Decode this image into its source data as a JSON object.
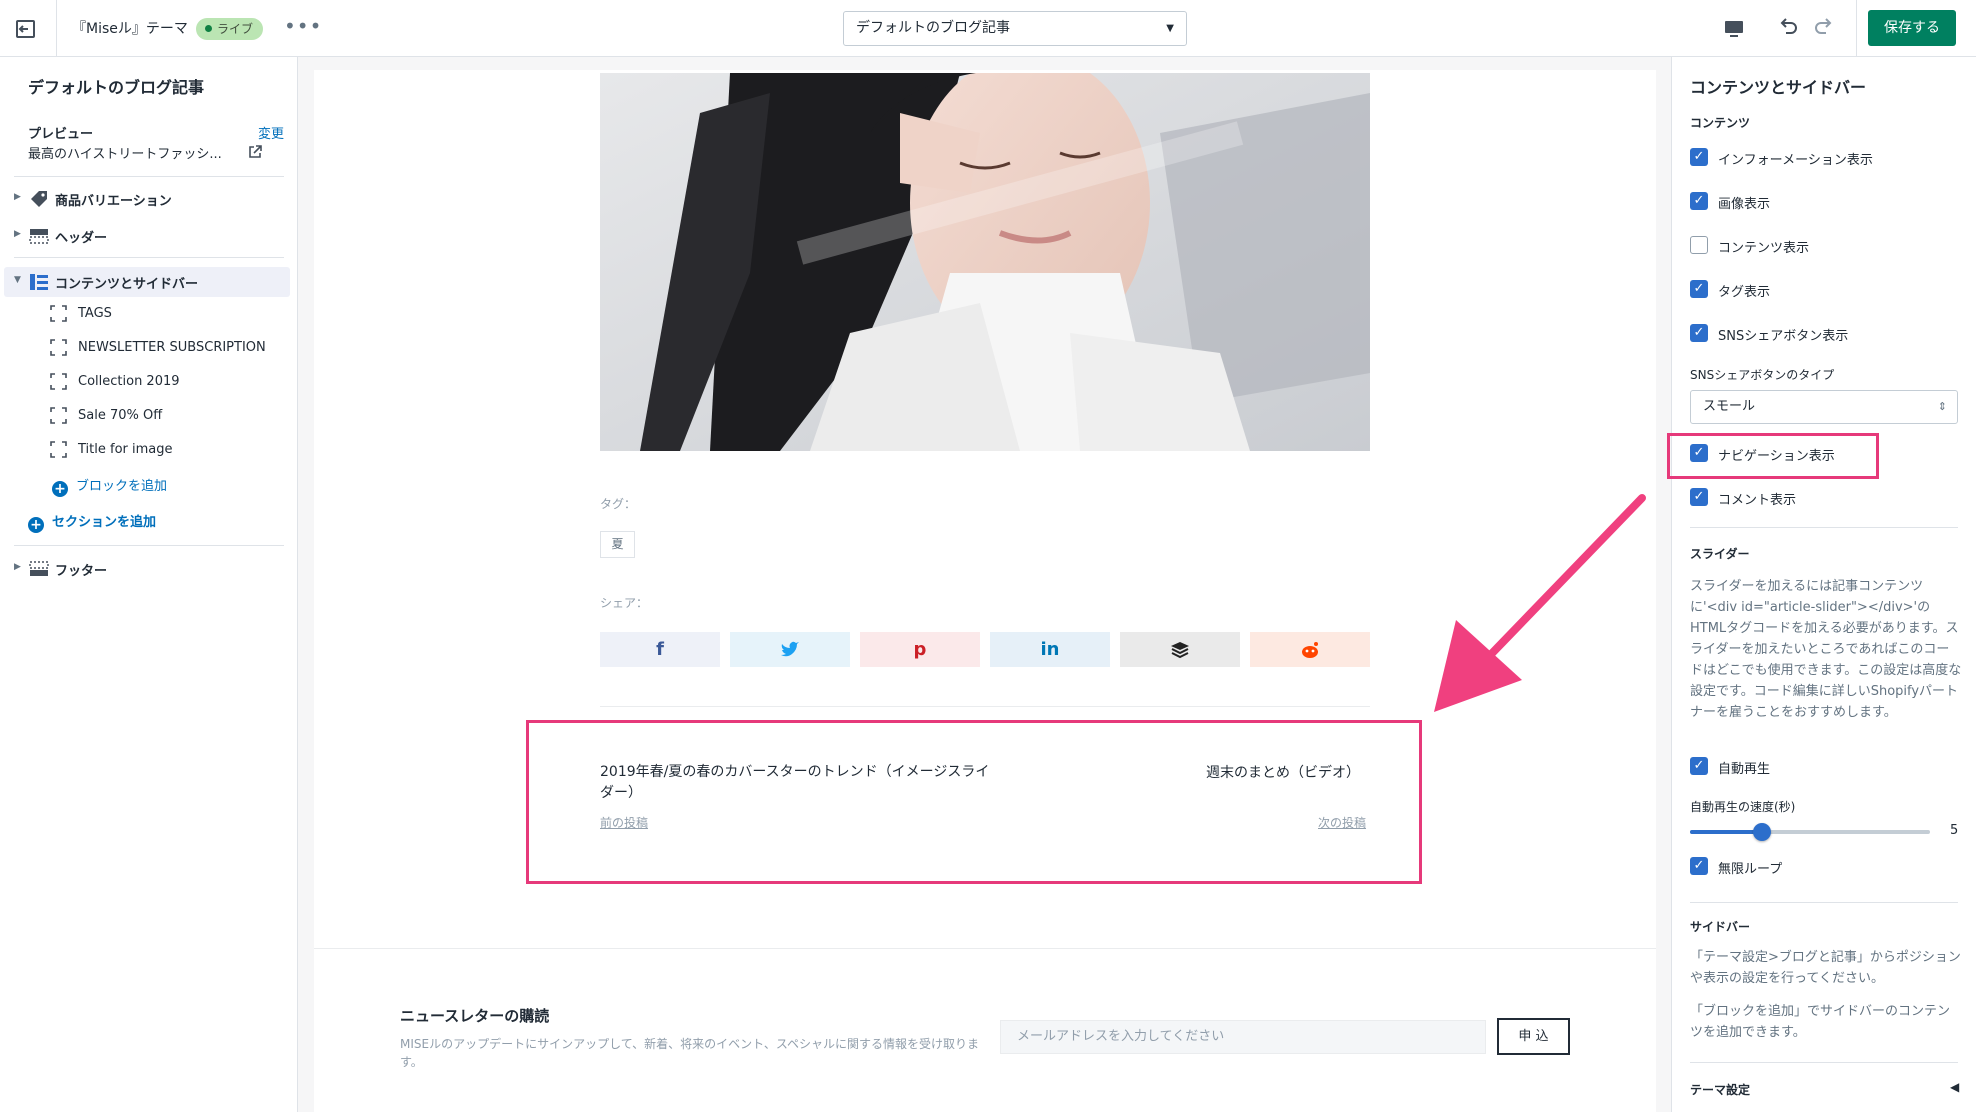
{
  "topbar": {
    "theme_name": "『Miseル』テーマ",
    "live_badge": "ライブ",
    "more": "•••",
    "template_select": "デフォルトのブログ記事",
    "save_label": "保存する",
    "save_color": "#008060"
  },
  "left": {
    "title": "デフォルトのブログ記事",
    "preview_label": "プレビュー",
    "preview_change": "変更",
    "preview_value": "最高のハイストリートファッシ...",
    "sections": {
      "product_variations": "商品バリエーション",
      "header": "ヘッダー",
      "content_sidebar": "コンテンツとサイドバー",
      "footer": "フッター"
    },
    "blocks": [
      "TAGS",
      "NEWSLETTER SUBSCRIPTION",
      "Collection 2019",
      "Sale 70% Off",
      "Title for image"
    ],
    "add_block": "ブロックを追加",
    "add_section": "セクションを追加"
  },
  "preview": {
    "tags_label": "タグ：",
    "tag_chip": "夏",
    "share_label": "シェア：",
    "share_icons": [
      "facebook-icon",
      "twitter-icon",
      "pinterest-icon",
      "linkedin-icon",
      "buffer-icon",
      "reddit-icon"
    ],
    "nav": {
      "prev_title": "2019年春/夏の春のカバースターのトレンド（イメージスライダー）",
      "prev_link": "前の投稿",
      "next_title": "週末のまとめ（ビデオ）",
      "next_link": "次の投稿"
    },
    "newsletter": {
      "title": "ニュースレターの購読",
      "description": "MISEルのアップデートにサインアップして、新着、将来のイベント、スペシャルに関する情報を受け取ります。",
      "placeholder": "メールアドレスを入力してください",
      "button": "申 込"
    },
    "highlight_color": "#e6397a"
  },
  "right": {
    "title": "コンテンツとサイドバー",
    "content_heading": "コンテンツ",
    "checkboxes": {
      "info": {
        "label": "インフォーメーション表示",
        "checked": true
      },
      "image": {
        "label": "画像表示",
        "checked": true
      },
      "content": {
        "label": "コンテンツ表示",
        "checked": false
      },
      "tags": {
        "label": "タグ表示",
        "checked": true
      },
      "sns": {
        "label": "SNSシェアボタン表示",
        "checked": true
      },
      "navigation": {
        "label": "ナビゲーション表示",
        "checked": true
      },
      "comments": {
        "label": "コメント表示",
        "checked": true
      },
      "autoplay": {
        "label": "自動再生",
        "checked": true
      },
      "loop": {
        "label": "無限ループ",
        "checked": true
      }
    },
    "sns_type_label": "SNSシェアボタンのタイプ",
    "sns_type_value": "スモール",
    "slider_heading": "スライダー",
    "slider_help": "スライダーを加えるには記事コンテンツに'<div id=\"article-slider\"></div>'のHTMLタグコードを加える必要があります。スライダーを加えたいところであればこのコードはどこでも使用できます。この設定は高度な設定です。コード編集に詳しいShopifyパートナーを雇うことをおすすめします。",
    "autoplay_speed_label": "自動再生の速度(秒)",
    "autoplay_speed_value": "5",
    "autoplay_speed_fraction": 0.3,
    "sidebar_heading": "サイドバー",
    "sidebar_help_1": "「テーマ設定>ブログと記事」からポジションや表示の設定を行ってください。",
    "sidebar_help_2": "「ブロックを追加」でサイドバーのコンテンツを追加できます。",
    "theme_settings": "テーマ設定"
  }
}
